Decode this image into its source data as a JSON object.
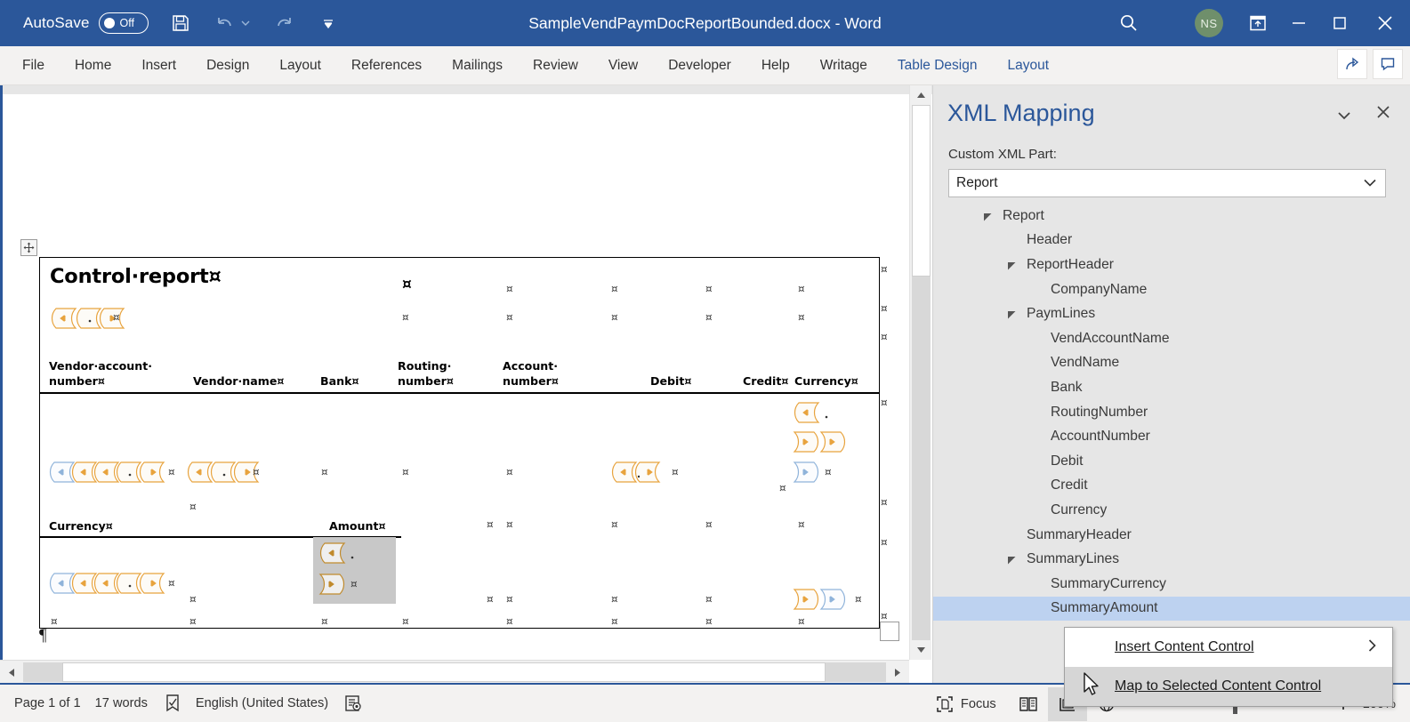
{
  "titlebar": {
    "autosave_label": "AutoSave",
    "autosave_state": "Off",
    "document_title": "SampleVendPaymDocReportBounded.docx  -  Word",
    "avatar_initials": "NS",
    "icons": {
      "save": "save-icon",
      "undo": "undo-icon",
      "undo_dropdown": "undo-dropdown-icon",
      "redo": "redo-icon",
      "customize_qat": "customize-quick-access-toolbar-icon",
      "search": "search-icon",
      "ribbon_display": "ribbon-display-options-icon",
      "minimize": "minimize-icon",
      "restore": "restore-icon",
      "close": "close-icon"
    }
  },
  "ribbon": {
    "tabs": [
      {
        "label": "File",
        "contextual": false
      },
      {
        "label": "Home",
        "contextual": false
      },
      {
        "label": "Insert",
        "contextual": false
      },
      {
        "label": "Design",
        "contextual": false
      },
      {
        "label": "Layout",
        "contextual": false
      },
      {
        "label": "References",
        "contextual": false
      },
      {
        "label": "Mailings",
        "contextual": false
      },
      {
        "label": "Review",
        "contextual": false
      },
      {
        "label": "View",
        "contextual": false
      },
      {
        "label": "Developer",
        "contextual": false
      },
      {
        "label": "Help",
        "contextual": false
      },
      {
        "label": "Writage",
        "contextual": false
      },
      {
        "label": "Table Design",
        "contextual": true
      },
      {
        "label": "Layout",
        "contextual": true
      }
    ],
    "share_icon": "share-icon",
    "comments_icon": "comments-icon"
  },
  "document": {
    "heading": "Control·report¤",
    "paragraph_mark": "¶",
    "column_headers": [
      {
        "line1": "Vendor·account·",
        "line2": "number¤"
      },
      {
        "line1": "",
        "line2": "Vendor·name¤"
      },
      {
        "line1": "",
        "line2": "Bank¤"
      },
      {
        "line1": "Routing·",
        "line2": "number¤"
      },
      {
        "line1": "Account·",
        "line2": "number¤"
      },
      {
        "line1": "",
        "line2": "Debit¤"
      },
      {
        "line1": "",
        "line2": "Credit¤"
      },
      {
        "line1": "",
        "line2": "Currency¤"
      }
    ],
    "summary_headers": [
      {
        "label": "Currency¤"
      },
      {
        "label": "Amount¤"
      }
    ],
    "cell_mark": "¤",
    "table_move_handle_icon": "table-move-handle-icon",
    "selected_cell_color": "#c8c8c8",
    "content_control_colors": {
      "plain_text": "#e8a33d",
      "repeating_section": "#8fb3da"
    }
  },
  "pane": {
    "title": "XML Mapping",
    "dropdown_icon": "chevron-down-icon",
    "close_icon": "close-icon",
    "sublabel": "Custom XML Part:",
    "combo_value": "Report",
    "combo_arrow_icon": "chevron-down-icon",
    "tree": [
      {
        "label": "Report",
        "depth": 0,
        "expandable": true,
        "selected": false
      },
      {
        "label": "Header",
        "depth": 1,
        "expandable": false,
        "selected": false
      },
      {
        "label": "ReportHeader",
        "depth": 1,
        "expandable": true,
        "selected": false
      },
      {
        "label": "CompanyName",
        "depth": 2,
        "expandable": false,
        "selected": false
      },
      {
        "label": "PaymLines",
        "depth": 1,
        "expandable": true,
        "selected": false
      },
      {
        "label": "VendAccountName",
        "depth": 2,
        "expandable": false,
        "selected": false
      },
      {
        "label": "VendName",
        "depth": 2,
        "expandable": false,
        "selected": false
      },
      {
        "label": "Bank",
        "depth": 2,
        "expandable": false,
        "selected": false
      },
      {
        "label": "RoutingNumber",
        "depth": 2,
        "expandable": false,
        "selected": false
      },
      {
        "label": "AccountNumber",
        "depth": 2,
        "expandable": false,
        "selected": false
      },
      {
        "label": "Debit",
        "depth": 2,
        "expandable": false,
        "selected": false
      },
      {
        "label": "Credit",
        "depth": 2,
        "expandable": false,
        "selected": false
      },
      {
        "label": "Currency",
        "depth": 2,
        "expandable": false,
        "selected": false
      },
      {
        "label": "SummaryHeader",
        "depth": 1,
        "expandable": false,
        "selected": false
      },
      {
        "label": "SummaryLines",
        "depth": 1,
        "expandable": true,
        "selected": false
      },
      {
        "label": "SummaryCurrency",
        "depth": 2,
        "expandable": false,
        "selected": false
      },
      {
        "label": "SummaryAmount",
        "depth": 2,
        "expandable": false,
        "selected": true
      }
    ],
    "selection_color": "#bdd2f0"
  },
  "context_menu": {
    "items": [
      {
        "label": "Insert Content Control",
        "accel": "I",
        "has_submenu": true,
        "highlighted": false
      },
      {
        "label": "Map to Selected Content Control",
        "accel": "M",
        "has_submenu": false,
        "highlighted": true
      }
    ],
    "submenu_arrow_icon": "chevron-right-icon",
    "cursor_icon": "mouse-pointer-icon"
  },
  "statusbar": {
    "page": "Page 1 of 1",
    "words": "17 words",
    "proofing_icon": "proofing-errors-icon",
    "language": "English (United States)",
    "accessibility_icon": "accessibility-checker-icon",
    "focus_label": "Focus",
    "focus_icon": "focus-mode-icon",
    "read_mode_icon": "read-mode-icon",
    "print_layout_icon": "print-layout-icon",
    "web_layout_icon": "web-layout-icon",
    "zoom_out_icon": "zoom-out-icon",
    "zoom_in_icon": "zoom-in-icon",
    "zoom_level": "100%"
  },
  "colors": {
    "word_blue": "#2b579a",
    "ribbon_bg": "#f3f2f1",
    "pane_bg": "#e6e6e6"
  }
}
